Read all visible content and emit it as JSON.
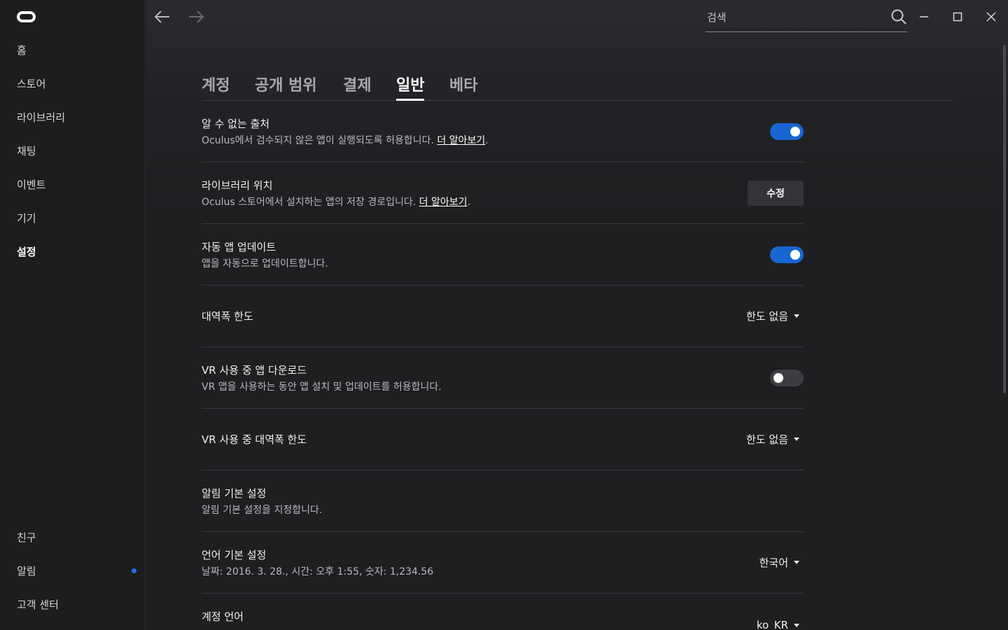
{
  "sidebar": {
    "top_items": [
      {
        "label": "홈"
      },
      {
        "label": "스토어"
      },
      {
        "label": "라이브러리"
      },
      {
        "label": "채팅"
      },
      {
        "label": "이벤트"
      },
      {
        "label": "기기"
      },
      {
        "label": "설정"
      }
    ],
    "bottom_items": [
      {
        "label": "친구"
      },
      {
        "label": "알림"
      },
      {
        "label": "고객 센터"
      }
    ],
    "active": "설정"
  },
  "search": {
    "placeholder": "검색",
    "value": ""
  },
  "tabs": [
    {
      "label": "계정"
    },
    {
      "label": "공개 범위"
    },
    {
      "label": "결제"
    },
    {
      "label": "일반"
    },
    {
      "label": "베타"
    }
  ],
  "active_tab": "일반",
  "settings": [
    {
      "title": "알 수 없는 출처",
      "desc": "Oculus에서 검수되지 않은 앱이 실행되도록 허용합니다. ",
      "link": "더 알아보기",
      "suffix": ".",
      "control": "toggle",
      "enabled": true
    },
    {
      "title": "라이브러리 위치",
      "desc": "Oculus 스토어에서 설치하는 앱의 저장 경로입니다. ",
      "link": "더 알아보기",
      "suffix": ".",
      "control": "button",
      "button_label": "수정"
    },
    {
      "title": "자동 앱 업데이트",
      "desc": "앱을 자동으로 업데이트합니다.",
      "control": "toggle",
      "enabled": true
    },
    {
      "title": "대역폭 한도",
      "control": "dropdown",
      "value": "한도 없음"
    },
    {
      "title": "VR 사용 중 앱 다운로드",
      "desc": "VR 앱을 사용하는 동안 앱 설치 및 업데이트를 허용합니다.",
      "control": "toggle",
      "enabled": false
    },
    {
      "title": "VR 사용 중 대역폭 한도",
      "control": "dropdown",
      "value": "한도 없음"
    },
    {
      "title": "알림 기본 설정",
      "desc": "알림 기본 설정을 지정합니다."
    },
    {
      "title": "언어 기본 설정",
      "desc": "날짜: 2016. 3. 28., 시간: 오후 1:55, 숫자: 1,234.56",
      "control": "dropdown",
      "value": "한국어"
    },
    {
      "title": "계정 언어",
      "control": "dropdown",
      "value": "ko_KR"
    }
  ],
  "colors": {
    "accent": "#1766d1",
    "notification_dot": "#1a73e8",
    "background": "#1e1f21"
  }
}
